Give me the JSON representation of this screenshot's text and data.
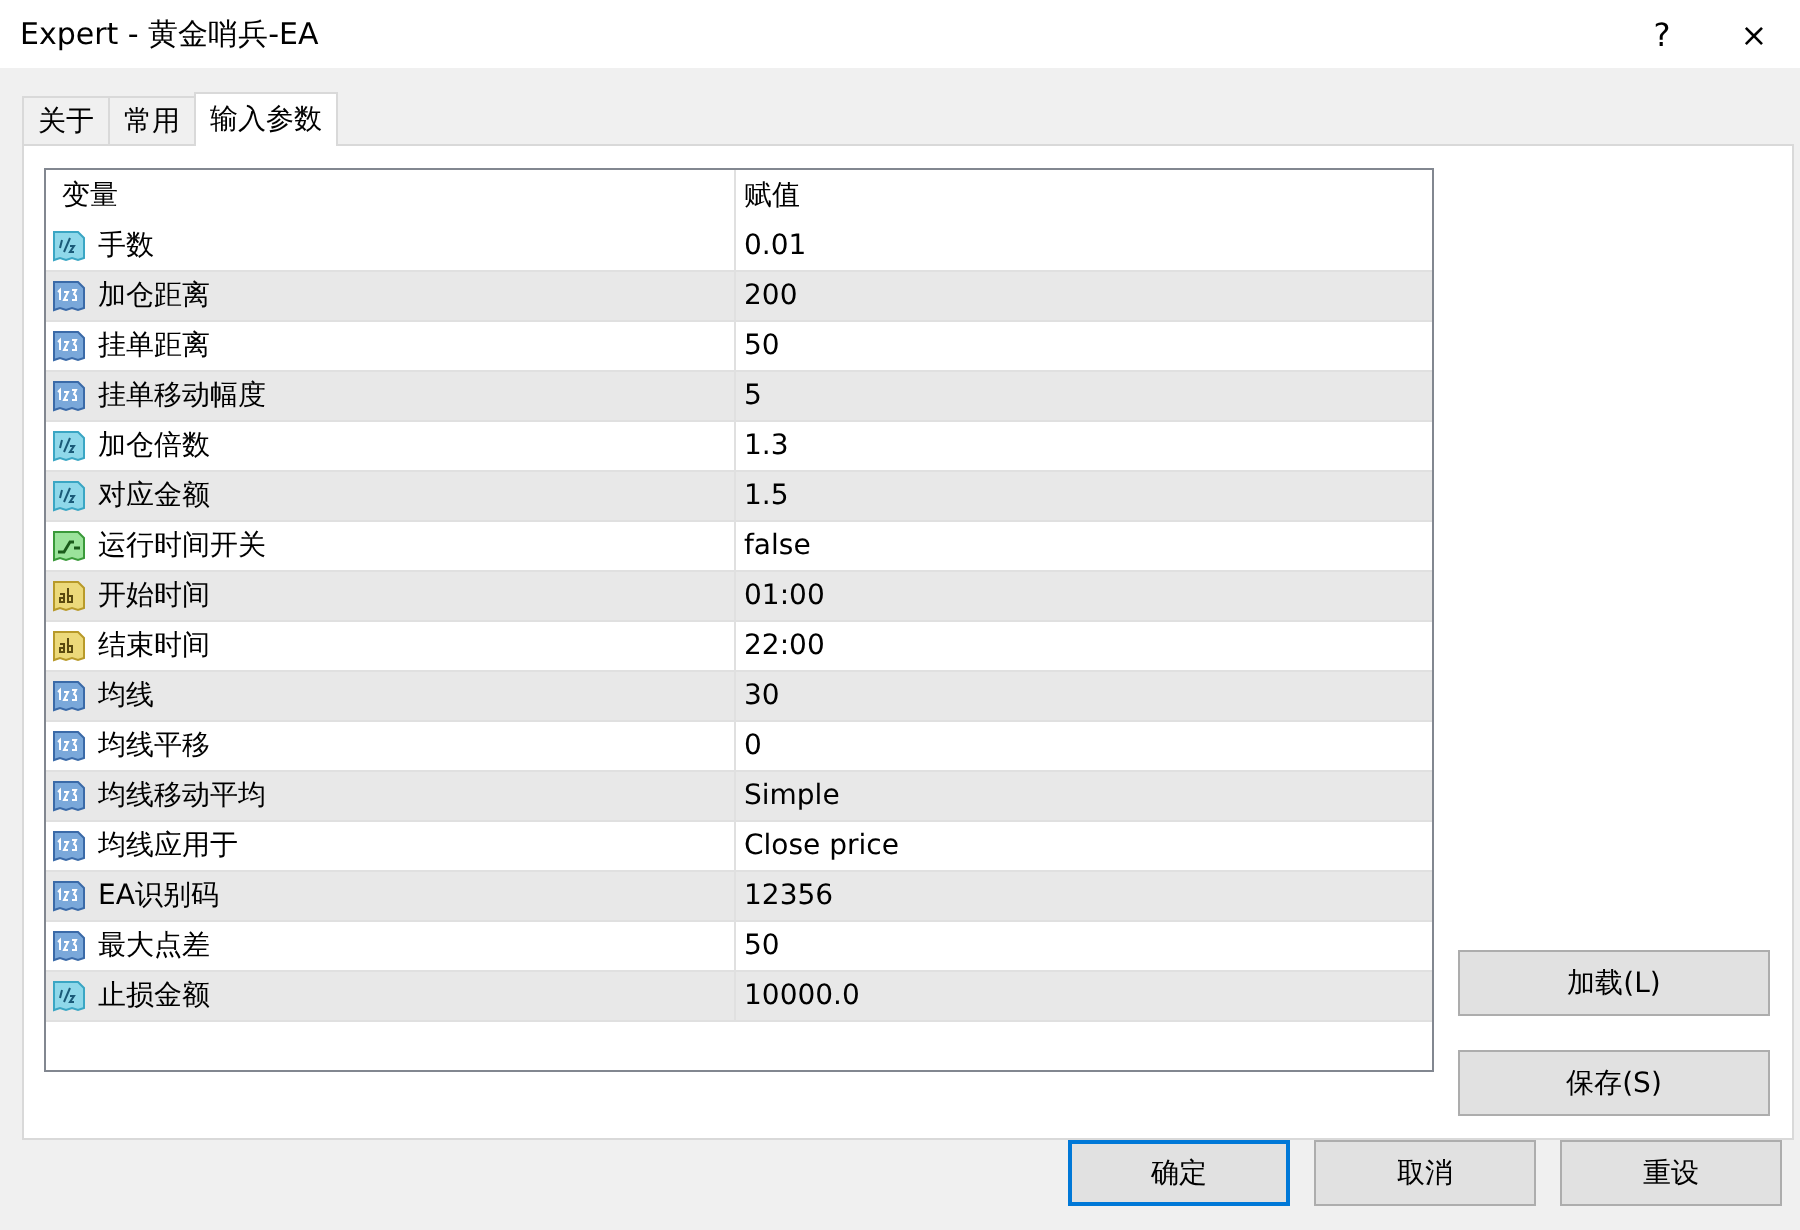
{
  "window": {
    "title": "Expert - 黄金哨兵-EA",
    "help_button": "?",
    "close_button": "×"
  },
  "tabs": [
    {
      "label": "关于",
      "selected": false
    },
    {
      "label": "常用",
      "selected": false
    },
    {
      "label": "输入参数",
      "selected": true
    }
  ],
  "table": {
    "columns": [
      "变量",
      "赋值"
    ],
    "rows": [
      {
        "kind": "double",
        "name": "手数",
        "value": "0.01"
      },
      {
        "kind": "int",
        "name": "加仓距离",
        "value": "200"
      },
      {
        "kind": "int",
        "name": "挂单距离",
        "value": "50"
      },
      {
        "kind": "int",
        "name": "挂单移动幅度",
        "value": "5"
      },
      {
        "kind": "double",
        "name": "加仓倍数",
        "value": "1.3"
      },
      {
        "kind": "double",
        "name": "对应金额",
        "value": "1.5"
      },
      {
        "kind": "bool",
        "name": "运行时间开关",
        "value": "false"
      },
      {
        "kind": "string",
        "name": "开始时间",
        "value": "01:00"
      },
      {
        "kind": "string",
        "name": "结束时间",
        "value": "22:00"
      },
      {
        "kind": "int",
        "name": "均线",
        "value": "30"
      },
      {
        "kind": "int",
        "name": "均线平移",
        "value": "0"
      },
      {
        "kind": "int",
        "name": "均线移动平均",
        "value": "Simple"
      },
      {
        "kind": "int",
        "name": "均线应用于",
        "value": "Close price"
      },
      {
        "kind": "int",
        "name": "EA识别码",
        "value": "12356"
      },
      {
        "kind": "int",
        "name": "最大点差",
        "value": "50"
      },
      {
        "kind": "double",
        "name": "止损金额",
        "value": "10000.0"
      }
    ]
  },
  "side_buttons": [
    "加载(L)",
    "保存(S)"
  ],
  "buttons": [
    {
      "label": "确定",
      "default": true
    },
    {
      "label": "取消",
      "default": false
    },
    {
      "label": "重设",
      "default": false
    }
  ]
}
